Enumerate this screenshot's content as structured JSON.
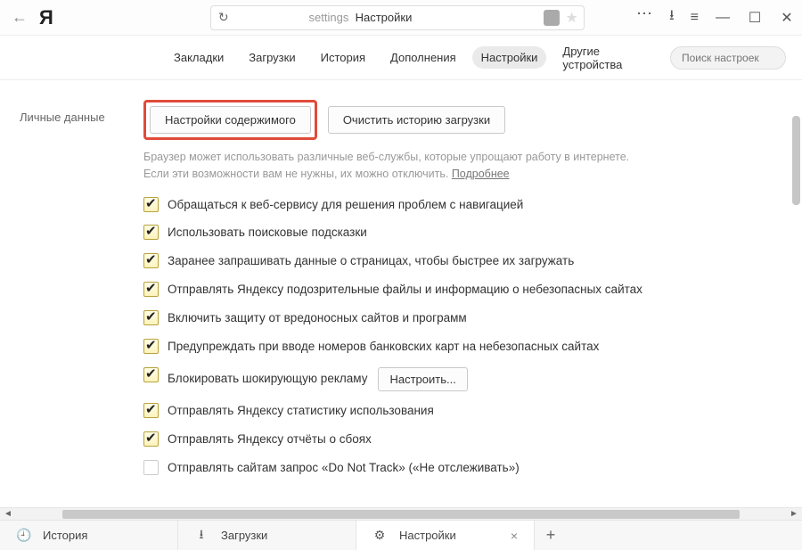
{
  "titlebar": {
    "ya_logo": "Я",
    "address_prefix": "settings",
    "address_title": "Настройки"
  },
  "nav": {
    "items": [
      {
        "label": "Закладки"
      },
      {
        "label": "Загрузки"
      },
      {
        "label": "История"
      },
      {
        "label": "Дополнения"
      },
      {
        "label": "Настройки"
      },
      {
        "label": "Другие устройства"
      }
    ],
    "search_placeholder": "Поиск настроек"
  },
  "section": {
    "side_label": "Личные данные",
    "btn_content": "Настройки содержимого",
    "btn_clear": "Очистить историю загрузки",
    "hint_line1": "Браузер может использовать различные веб-службы, которые упрощают работу в интернете.",
    "hint_line2": "Если эти возможности вам не нужны, их можно отключить.",
    "hint_more": "Подробнее",
    "configure_btn": "Настроить...",
    "options": [
      {
        "label": "Обращаться к веб-сервису для решения проблем с навигацией",
        "checked": true
      },
      {
        "label": "Использовать поисковые подсказки",
        "checked": true
      },
      {
        "label": "Заранее запрашивать данные о страницах, чтобы быстрее их загружать",
        "checked": true
      },
      {
        "label": "Отправлять Яндексу подозрительные файлы и информацию о небезопасных сайтах",
        "checked": true
      },
      {
        "label": "Включить защиту от вредоносных сайтов и программ",
        "checked": true
      },
      {
        "label": "Предупреждать при вводе номеров банковских карт на небезопасных сайтах",
        "checked": true
      },
      {
        "label": "Блокировать шокирующую рекламу",
        "checked": true,
        "has_button": true
      },
      {
        "label": "Отправлять Яндексу статистику использования",
        "checked": true
      },
      {
        "label": "Отправлять Яндексу отчёты о сбоях",
        "checked": true
      },
      {
        "label": "Отправлять сайтам запрос «Do Not Track» («Не отслеживать»)",
        "checked": false
      }
    ]
  },
  "tabs": {
    "items": [
      {
        "icon": "history-icon",
        "label": "История"
      },
      {
        "icon": "download-icon",
        "label": "Загрузки"
      },
      {
        "icon": "gear-icon",
        "label": "Настройки",
        "active": true
      }
    ]
  }
}
